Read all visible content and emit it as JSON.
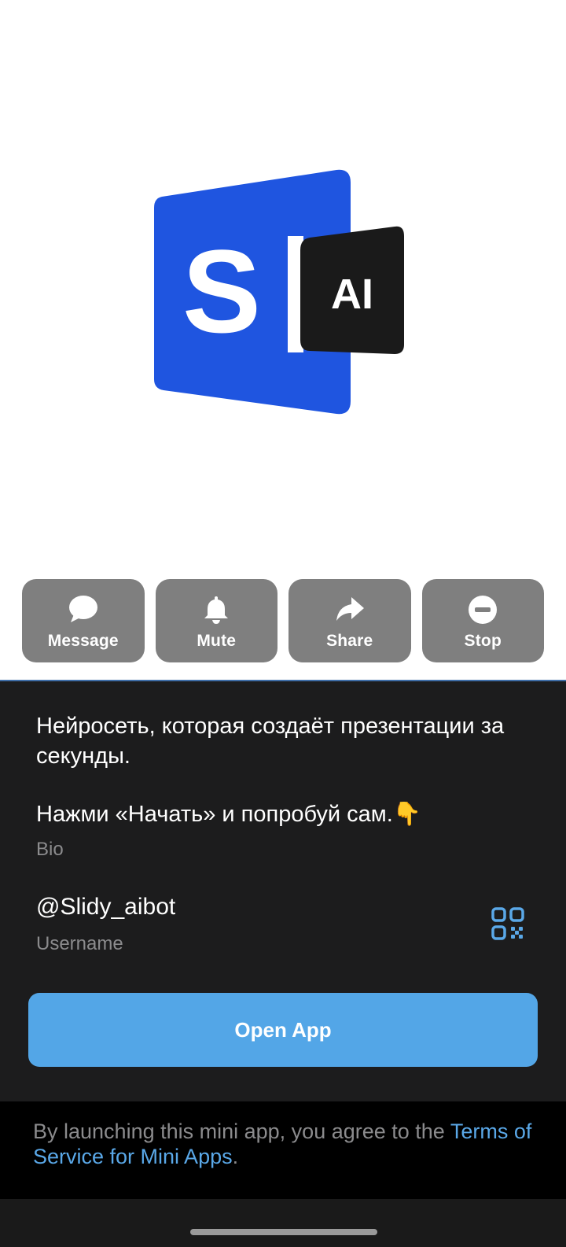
{
  "profile": {
    "logo_text": "AI",
    "logo_letter": "S"
  },
  "actions": [
    {
      "label": "Message",
      "icon": "message-icon"
    },
    {
      "label": "Mute",
      "icon": "bell-icon"
    },
    {
      "label": "Share",
      "icon": "share-icon"
    },
    {
      "label": "Stop",
      "icon": "stop-icon"
    }
  ],
  "info": {
    "bio_line1": "Нейросеть, которая создаёт презентации за секунды.",
    "bio_line2": "Нажми «Начать» и попробуй сам.👇",
    "bio_label": "Bio",
    "username": "@Slidy_aibot",
    "username_label": "Username",
    "qr_icon": "qr-code-icon"
  },
  "open_app_label": "Open App",
  "terms": {
    "prefix": "By launching this mini app, you agree to the ",
    "link": "Terms of Service for Mini Apps",
    "suffix": "."
  },
  "colors": {
    "accent": "#53a6e7",
    "logo_blue": "#1f55e0",
    "action_bg": "#7f7f7f",
    "card_bg": "#1c1c1d"
  }
}
